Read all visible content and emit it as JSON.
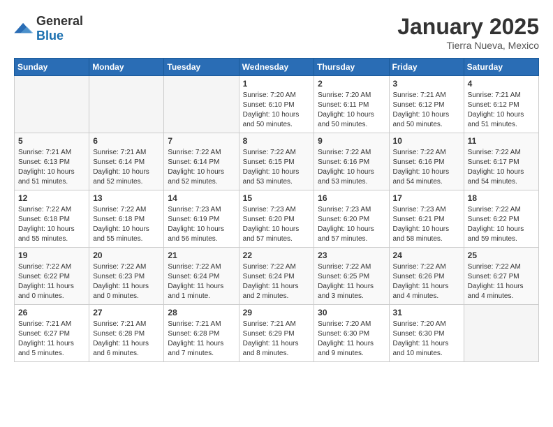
{
  "logo": {
    "general": "General",
    "blue": "Blue"
  },
  "header": {
    "month": "January 2025",
    "location": "Tierra Nueva, Mexico"
  },
  "weekdays": [
    "Sunday",
    "Monday",
    "Tuesday",
    "Wednesday",
    "Thursday",
    "Friday",
    "Saturday"
  ],
  "weeks": [
    {
      "days": [
        {
          "number": "",
          "empty": true
        },
        {
          "number": "",
          "empty": true
        },
        {
          "number": "",
          "empty": true
        },
        {
          "number": "1",
          "sunrise": "7:20 AM",
          "sunset": "6:10 PM",
          "daylight": "10 hours and 50 minutes."
        },
        {
          "number": "2",
          "sunrise": "7:20 AM",
          "sunset": "6:11 PM",
          "daylight": "10 hours and 50 minutes."
        },
        {
          "number": "3",
          "sunrise": "7:21 AM",
          "sunset": "6:12 PM",
          "daylight": "10 hours and 50 minutes."
        },
        {
          "number": "4",
          "sunrise": "7:21 AM",
          "sunset": "6:12 PM",
          "daylight": "10 hours and 51 minutes."
        }
      ]
    },
    {
      "days": [
        {
          "number": "5",
          "sunrise": "7:21 AM",
          "sunset": "6:13 PM",
          "daylight": "10 hours and 51 minutes."
        },
        {
          "number": "6",
          "sunrise": "7:21 AM",
          "sunset": "6:14 PM",
          "daylight": "10 hours and 52 minutes."
        },
        {
          "number": "7",
          "sunrise": "7:22 AM",
          "sunset": "6:14 PM",
          "daylight": "10 hours and 52 minutes."
        },
        {
          "number": "8",
          "sunrise": "7:22 AM",
          "sunset": "6:15 PM",
          "daylight": "10 hours and 53 minutes."
        },
        {
          "number": "9",
          "sunrise": "7:22 AM",
          "sunset": "6:16 PM",
          "daylight": "10 hours and 53 minutes."
        },
        {
          "number": "10",
          "sunrise": "7:22 AM",
          "sunset": "6:16 PM",
          "daylight": "10 hours and 54 minutes."
        },
        {
          "number": "11",
          "sunrise": "7:22 AM",
          "sunset": "6:17 PM",
          "daylight": "10 hours and 54 minutes."
        }
      ]
    },
    {
      "days": [
        {
          "number": "12",
          "sunrise": "7:22 AM",
          "sunset": "6:18 PM",
          "daylight": "10 hours and 55 minutes."
        },
        {
          "number": "13",
          "sunrise": "7:22 AM",
          "sunset": "6:18 PM",
          "daylight": "10 hours and 55 minutes."
        },
        {
          "number": "14",
          "sunrise": "7:23 AM",
          "sunset": "6:19 PM",
          "daylight": "10 hours and 56 minutes."
        },
        {
          "number": "15",
          "sunrise": "7:23 AM",
          "sunset": "6:20 PM",
          "daylight": "10 hours and 57 minutes."
        },
        {
          "number": "16",
          "sunrise": "7:23 AM",
          "sunset": "6:20 PM",
          "daylight": "10 hours and 57 minutes."
        },
        {
          "number": "17",
          "sunrise": "7:23 AM",
          "sunset": "6:21 PM",
          "daylight": "10 hours and 58 minutes."
        },
        {
          "number": "18",
          "sunrise": "7:22 AM",
          "sunset": "6:22 PM",
          "daylight": "10 hours and 59 minutes."
        }
      ]
    },
    {
      "days": [
        {
          "number": "19",
          "sunrise": "7:22 AM",
          "sunset": "6:22 PM",
          "daylight": "11 hours and 0 minutes."
        },
        {
          "number": "20",
          "sunrise": "7:22 AM",
          "sunset": "6:23 PM",
          "daylight": "11 hours and 0 minutes."
        },
        {
          "number": "21",
          "sunrise": "7:22 AM",
          "sunset": "6:24 PM",
          "daylight": "11 hours and 1 minute."
        },
        {
          "number": "22",
          "sunrise": "7:22 AM",
          "sunset": "6:24 PM",
          "daylight": "11 hours and 2 minutes."
        },
        {
          "number": "23",
          "sunrise": "7:22 AM",
          "sunset": "6:25 PM",
          "daylight": "11 hours and 3 minutes."
        },
        {
          "number": "24",
          "sunrise": "7:22 AM",
          "sunset": "6:26 PM",
          "daylight": "11 hours and 4 minutes."
        },
        {
          "number": "25",
          "sunrise": "7:22 AM",
          "sunset": "6:27 PM",
          "daylight": "11 hours and 4 minutes."
        }
      ]
    },
    {
      "days": [
        {
          "number": "26",
          "sunrise": "7:21 AM",
          "sunset": "6:27 PM",
          "daylight": "11 hours and 5 minutes."
        },
        {
          "number": "27",
          "sunrise": "7:21 AM",
          "sunset": "6:28 PM",
          "daylight": "11 hours and 6 minutes."
        },
        {
          "number": "28",
          "sunrise": "7:21 AM",
          "sunset": "6:28 PM",
          "daylight": "11 hours and 7 minutes."
        },
        {
          "number": "29",
          "sunrise": "7:21 AM",
          "sunset": "6:29 PM",
          "daylight": "11 hours and 8 minutes."
        },
        {
          "number": "30",
          "sunrise": "7:20 AM",
          "sunset": "6:30 PM",
          "daylight": "11 hours and 9 minutes."
        },
        {
          "number": "31",
          "sunrise": "7:20 AM",
          "sunset": "6:30 PM",
          "daylight": "11 hours and 10 minutes."
        },
        {
          "number": "",
          "empty": true
        }
      ]
    }
  ]
}
